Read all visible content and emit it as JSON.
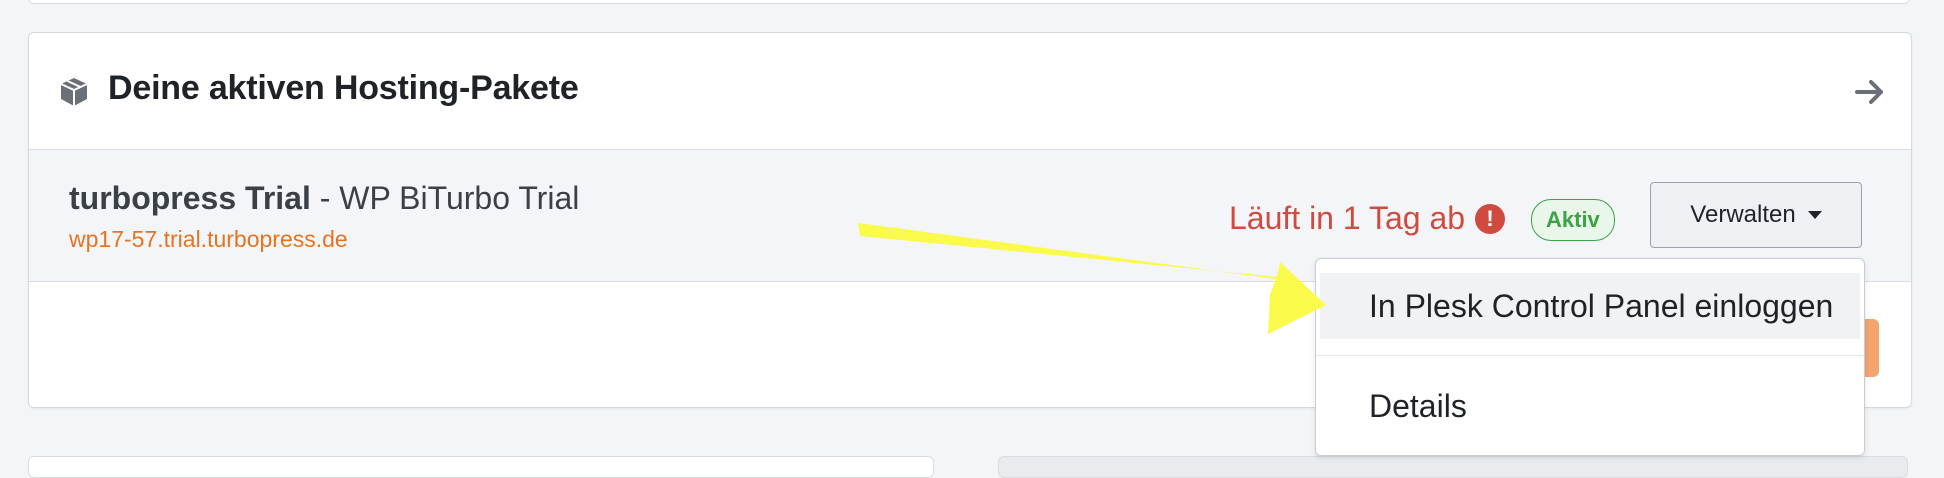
{
  "card": {
    "title": "Deine aktiven Hosting-Pakete",
    "icon": "box-icon",
    "link_icon": "arrow-right-icon"
  },
  "package": {
    "name_bold": "turbopress Trial",
    "name_rest": " - WP BiTurbo Trial",
    "domain": "wp17-57.trial.turbopress.de",
    "expiry": "Läuft in 1 Tag ab",
    "expiry_icon": "!",
    "status": "Aktiv",
    "manage_label": "Verwalten"
  },
  "dropdown": {
    "items": [
      {
        "label": "In Plesk Control Panel einloggen"
      },
      {
        "label": "Details"
      }
    ]
  },
  "colors": {
    "accent_orange": "#e8731f",
    "warning_red": "#d04b3f",
    "status_green": "#3da146",
    "annotation_yellow": "#fafa4a"
  }
}
